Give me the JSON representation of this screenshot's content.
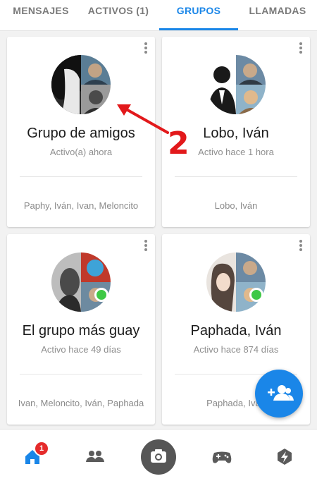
{
  "tabs": [
    {
      "label": "MENSAJES",
      "active": false
    },
    {
      "label": "ACTIVOS (1)",
      "active": false
    },
    {
      "label": "GRUPOS",
      "active": true
    },
    {
      "label": "LLAMADAS",
      "active": false
    }
  ],
  "groups": [
    {
      "name": "Grupo de amigos",
      "status": "Activo(a) ahora",
      "members": "Paphy, Iván, Ivan, Meloncito"
    },
    {
      "name": "Lobo, Iván",
      "status": "Activo hace 1 hora",
      "members": "Lobo, Iván"
    },
    {
      "name": "El grupo más guay",
      "status": "Activo hace 49 días",
      "members": "Ivan, Meloncito, Iván, Paphada"
    },
    {
      "name": "Paphada, Iván",
      "status": "Activo hace 874 días",
      "members": "Paphada, Iván"
    }
  ],
  "annotation": {
    "number": "2"
  },
  "bottom_nav": {
    "items": [
      "home-icon",
      "people-icon",
      "camera-icon",
      "game-controller-icon",
      "discover-icon"
    ],
    "badge_count": "1"
  },
  "colors": {
    "accent": "#1a86e8",
    "online": "#3ec846",
    "annotation": "#e2191b",
    "badge": "#e52b2b"
  }
}
